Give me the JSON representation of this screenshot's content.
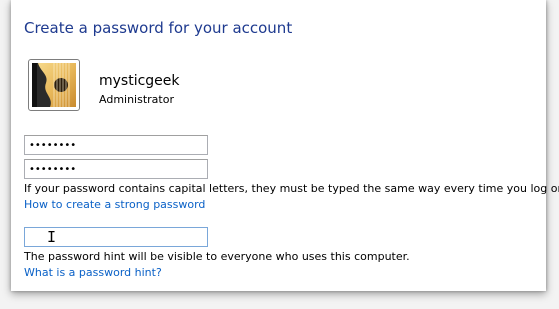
{
  "page": {
    "title": "Create a password for your account"
  },
  "user": {
    "name": "mysticgeek",
    "role": "Administrator",
    "avatar_icon": "guitar-icon"
  },
  "form": {
    "new_password_value": "••••••••",
    "confirm_password_value": "••••••••",
    "password_note": "If your password contains capital letters, they must be typed the same way every time you log on.",
    "strong_password_link": "How to create a strong password",
    "hint_value": "",
    "hint_note": "The password hint will be visible to everyone who uses this computer.",
    "hint_link": "What is a password hint?"
  },
  "colors": {
    "title": "#1e3a8f",
    "link": "#0a61c7",
    "focus_border": "#7aa7d9"
  }
}
